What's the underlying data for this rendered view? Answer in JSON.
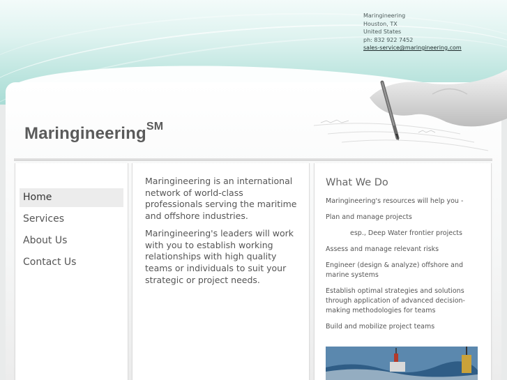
{
  "contact": {
    "company": "Maringineering",
    "city": "Houston, TX",
    "country": "United States",
    "phone": "ph: 832 922 7452",
    "email": "sales-service@maringineering.com"
  },
  "site": {
    "title": "Maringineering",
    "service_mark": "SM"
  },
  "nav": {
    "items": [
      {
        "label": "Home",
        "active": true
      },
      {
        "label": "Services",
        "active": false
      },
      {
        "label": "About Us",
        "active": false
      },
      {
        "label": "Contact Us",
        "active": false
      }
    ]
  },
  "main": {
    "paragraphs": [
      "Maringineering is an international network of world-class professionals serving the maritime and offshore industries.",
      "Maringineering's leaders will work with you to establish working relationships with high quality teams or individuals to suit your strategic or project needs."
    ]
  },
  "sidebar": {
    "heading": "What We Do",
    "items": [
      "Maringineering's resources will help you -",
      "Plan and manage projects",
      "esp., Deep Water frontier projects",
      "Assess and manage relevant risks",
      "Engineer (design & analyze) offshore and marine systems",
      "Establish optimal strategies and solutions through application of advanced decision-making methodologies for teams",
      "Build and mobilize project teams"
    ]
  },
  "colors": {
    "banner_teal": "#a9dcd5",
    "nav_active_bg": "#ececec",
    "text_gray": "#555555"
  },
  "icons": {
    "header_illustration": "hand-writing-with-pen",
    "sidebar_photo": "ship-at-sea-photo"
  }
}
